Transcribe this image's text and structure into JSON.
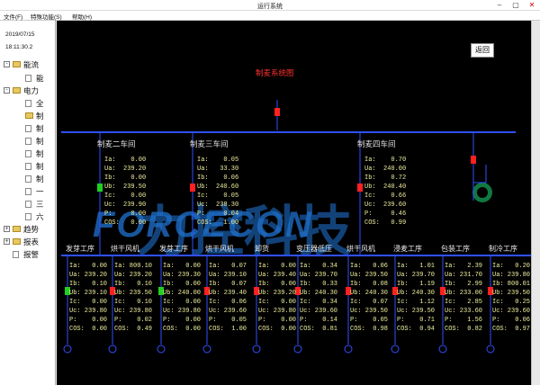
{
  "window": {
    "title": "运行系统",
    "minimize": "–",
    "maximize": "▢",
    "close": "✕"
  },
  "menu": [
    "文件(F)",
    "特殊功能(S)",
    "帮助(H)"
  ],
  "left": {
    "date": "2019/07/15",
    "time": "18:11:30.2",
    "tree": [
      {
        "label": "能流",
        "level": 0,
        "toggle": "-",
        "icon": "folder"
      },
      {
        "label": "能",
        "level": 1,
        "toggle": "",
        "icon": "doc"
      },
      {
        "label": "电力",
        "level": 0,
        "toggle": "-",
        "icon": "folder"
      },
      {
        "label": "全",
        "level": 1,
        "toggle": "",
        "icon": "doc"
      },
      {
        "label": "制",
        "level": 1,
        "toggle": "",
        "icon": "folder"
      },
      {
        "label": "制",
        "level": 1,
        "toggle": "",
        "icon": "doc"
      },
      {
        "label": "制",
        "level": 1,
        "toggle": "",
        "icon": "doc"
      },
      {
        "label": "制",
        "level": 1,
        "toggle": "",
        "icon": "doc"
      },
      {
        "label": "制",
        "level": 1,
        "toggle": "",
        "icon": "doc"
      },
      {
        "label": "制",
        "level": 1,
        "toggle": "",
        "icon": "doc"
      },
      {
        "label": "一",
        "level": 1,
        "toggle": "",
        "icon": "doc"
      },
      {
        "label": "三",
        "level": 1,
        "toggle": "",
        "icon": "doc"
      },
      {
        "label": "六",
        "level": 1,
        "toggle": "",
        "icon": "doc"
      },
      {
        "label": "趋势",
        "level": 0,
        "toggle": "+",
        "icon": "folder"
      },
      {
        "label": "报表",
        "level": 0,
        "toggle": "+",
        "icon": "folder"
      },
      {
        "label": "报警",
        "level": 0,
        "toggle": "",
        "icon": "doc"
      }
    ]
  },
  "main": {
    "back": "返回",
    "diagram_title": "制麦系统图",
    "watermark_cn": "力控科技",
    "watermark_en": "FORCECON",
    "sections": [
      {
        "title": "制麦二车间",
        "data": "Ia:    0.00\nUa:  239.20\nIb:    0.00\nUb:  239.50\nIc:    0.00\nUc:  239.90\nP:     0.00\nCOS:   0.00"
      },
      {
        "title": "制麦三车间",
        "data": "Ia:    0.05\nUa:   33.30\nIb:    0.06\nUb:  240.60\nIc:    0.05\nUc:  238.30\nP:     0.04\nCOS:   1.00"
      },
      {
        "title": "制麦四车间",
        "data": "Ia:    0.70\nUa:  240.00\nIb:    0.72\nUb:  240.40\nIc:    0.66\nUc:  239.60\nP:     0.46\nCOS:   0.99"
      }
    ],
    "feeders": [
      {
        "title": "发芽工序",
        "data": "Ia:   0.00\nUa: 239.20\nIb:   0.10\nUb: 239.10\nIc:   0.00\nUc: 239.80\nP:    0.00\nCOS:  0.00",
        "state": "green"
      },
      {
        "title": "烘干风机",
        "data": "Ia: 800.10\nUa: 239.20\nIb:   0.10\nUb: 239.50\nIc:   0.10\nUc: 239.80\nP:    0.02\nCOS:  0.49",
        "state": "red"
      },
      {
        "title": "发芽工序",
        "data": "Ia:   0.00\nUa: 239.30\nIb:   0.00\nUb: 240.00\nIc:   0.00\nUc: 239.80\nP:    0.00\nCOS:  0.00",
        "state": "green"
      },
      {
        "title": "烘干风机",
        "data": "Ia:   0.07\nUa: 239.10\nIb:   0.07\nUb: 239.40\nIc:   0.06\nUc: 239.60\nP:    0.05\nCOS:  1.00",
        "state": "red"
      },
      {
        "title": "卸货",
        "data": "Ia:   0.00\nUa: 239.40\nIb:   0.00\nUb: 239.20\nIc:   0.00\nUc: 239.80\nP:    0.00\nCOS:  0.00",
        "state": "red"
      },
      {
        "title": "变压器低压",
        "data": "Ia:   0.34\nUa: 239.70\nIb:   0.33\nUb: 240.30\nIc:   0.34\nUc: 239.60\nP:    0.14\nCOS:  0.81",
        "state": "red"
      },
      {
        "title": "烘干风机",
        "data": "Ia:   0.06\nUa: 239.50\nIb:   0.08\nUb: 240.30\nIc:   0.07\nUc: 239.50\nP:    0.05\nCOS:  0.98",
        "state": "red"
      },
      {
        "title": "浸麦工序",
        "data": "Ia:   1.01\nUa: 239.70\nIb:   1.19\nUb: 240.30\nIc:   1.12\nUc: 239.50\nP:    0.71\nCOS:  0.94",
        "state": "red"
      },
      {
        "title": "包装工序",
        "data": "Ia:   2.39\nUa: 231.70\nIb:   2.99\nUb: 233.00\nIc:   2.85\nUc: 233.60\nP:    1.56\nCOS:  0.82",
        "state": "red"
      },
      {
        "title": "制冷工序",
        "data": "Ia:   0.20\nUa: 239.80\nIb: 800.01\nUb: 239.50\nIc:   0.25\nUc: 239.60\nP:    0.06\nCOS:  0.97",
        "state": "red"
      }
    ]
  },
  "colors": {
    "bus": "#3050ff",
    "breaker_on": "#ff2020",
    "breaker_off": "#20d020",
    "data": "#f0f0a0"
  }
}
